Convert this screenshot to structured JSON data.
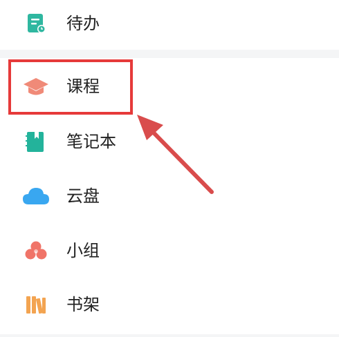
{
  "menu": {
    "items": [
      {
        "label": "待办",
        "icon": "todo-icon"
      },
      {
        "label": "课程",
        "icon": "course-icon"
      },
      {
        "label": "笔记本",
        "icon": "notebook-icon"
      },
      {
        "label": "云盘",
        "icon": "cloud-drive-icon"
      },
      {
        "label": "小组",
        "icon": "group-icon"
      },
      {
        "label": "书架",
        "icon": "bookshelf-icon"
      }
    ]
  },
  "colors": {
    "todo": "#2fb7a0",
    "course": "#f08a78",
    "notebook": "#23b39b",
    "cloud": "#39a7f0",
    "group": "#f07468",
    "bookshelf": "#f3a451",
    "highlight": "#e63a3a",
    "arrow": "#d94c4c"
  }
}
